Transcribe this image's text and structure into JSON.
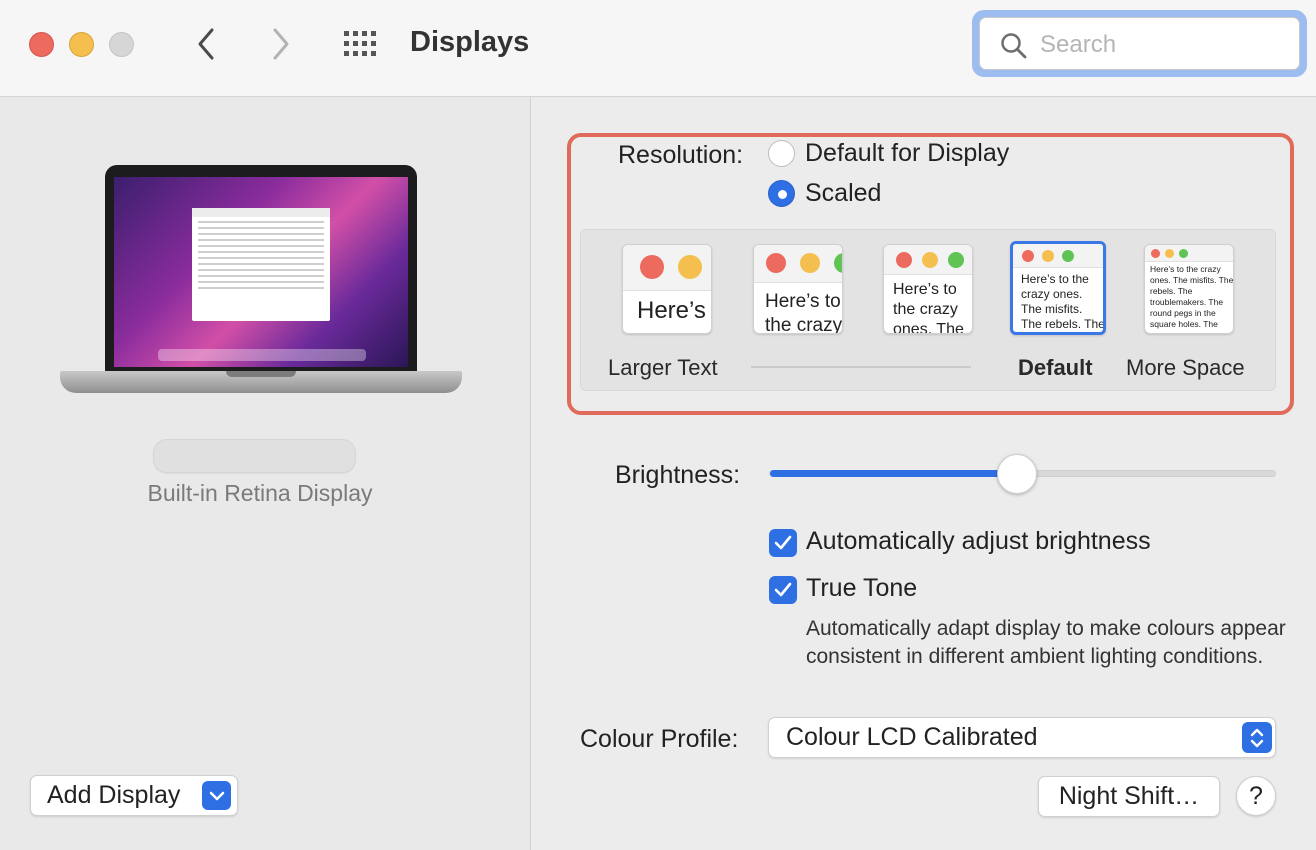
{
  "window": {
    "title": "Displays",
    "search_placeholder": "Search"
  },
  "left": {
    "display_caption": "Built-in Retina Display",
    "add_display_label": "Add Display"
  },
  "resolution": {
    "label": "Resolution:",
    "options": [
      "Default for Display",
      "Scaled"
    ],
    "selected": "Scaled",
    "scale_thumbs": [
      {
        "text": "Here’s"
      },
      {
        "text": "Here’s to the crazy ones. The misfits. The rebels. The troublemakers."
      },
      {
        "text": "Here’s to the crazy ones. The misfits. The rebels. The troublemakers. The round pegs in the square holes. The ones who see things differently."
      },
      {
        "text": "Here’s to the crazy ones. The misfits. The rebels. The troublemakers. The round pegs in the square holes. The ones who see things differently. They’re not fond of rules. And they have no respect for the status quo."
      },
      {
        "text": "Here’s to the crazy ones. The misfits. The rebels. The troublemakers. The round pegs in the square holes. The ones who see things differently. They’re not fond of rules. And they have no respect for the status quo. You can quote them, disagree with them, glorify or vilify them. About the only thing you can’t do is ignore them. Because they change things."
      }
    ],
    "caption_larger": "Larger Text",
    "caption_default": "Default",
    "caption_more": "More Space",
    "selected_scale_index": 3
  },
  "brightness": {
    "label": "Brightness:",
    "level": 0.49
  },
  "checkboxes": {
    "auto_brightness": {
      "label": "Automatically adjust brightness",
      "checked": true
    },
    "true_tone": {
      "label": "True Tone",
      "checked": true,
      "description": "Automatically adapt display to make colours appear consistent in different ambient lighting conditions."
    }
  },
  "colour_profile": {
    "label": "Colour Profile:",
    "value": "Colour LCD Calibrated"
  },
  "buttons": {
    "night_shift": "Night Shift…",
    "help": "?"
  },
  "colors": {
    "accent": "#2f6fe4",
    "highlight_box": "#e06b5b",
    "traffic_red": "#ed6a5e",
    "traffic_yellow": "#f4bf4f",
    "traffic_gray": "#d6d6d6"
  }
}
